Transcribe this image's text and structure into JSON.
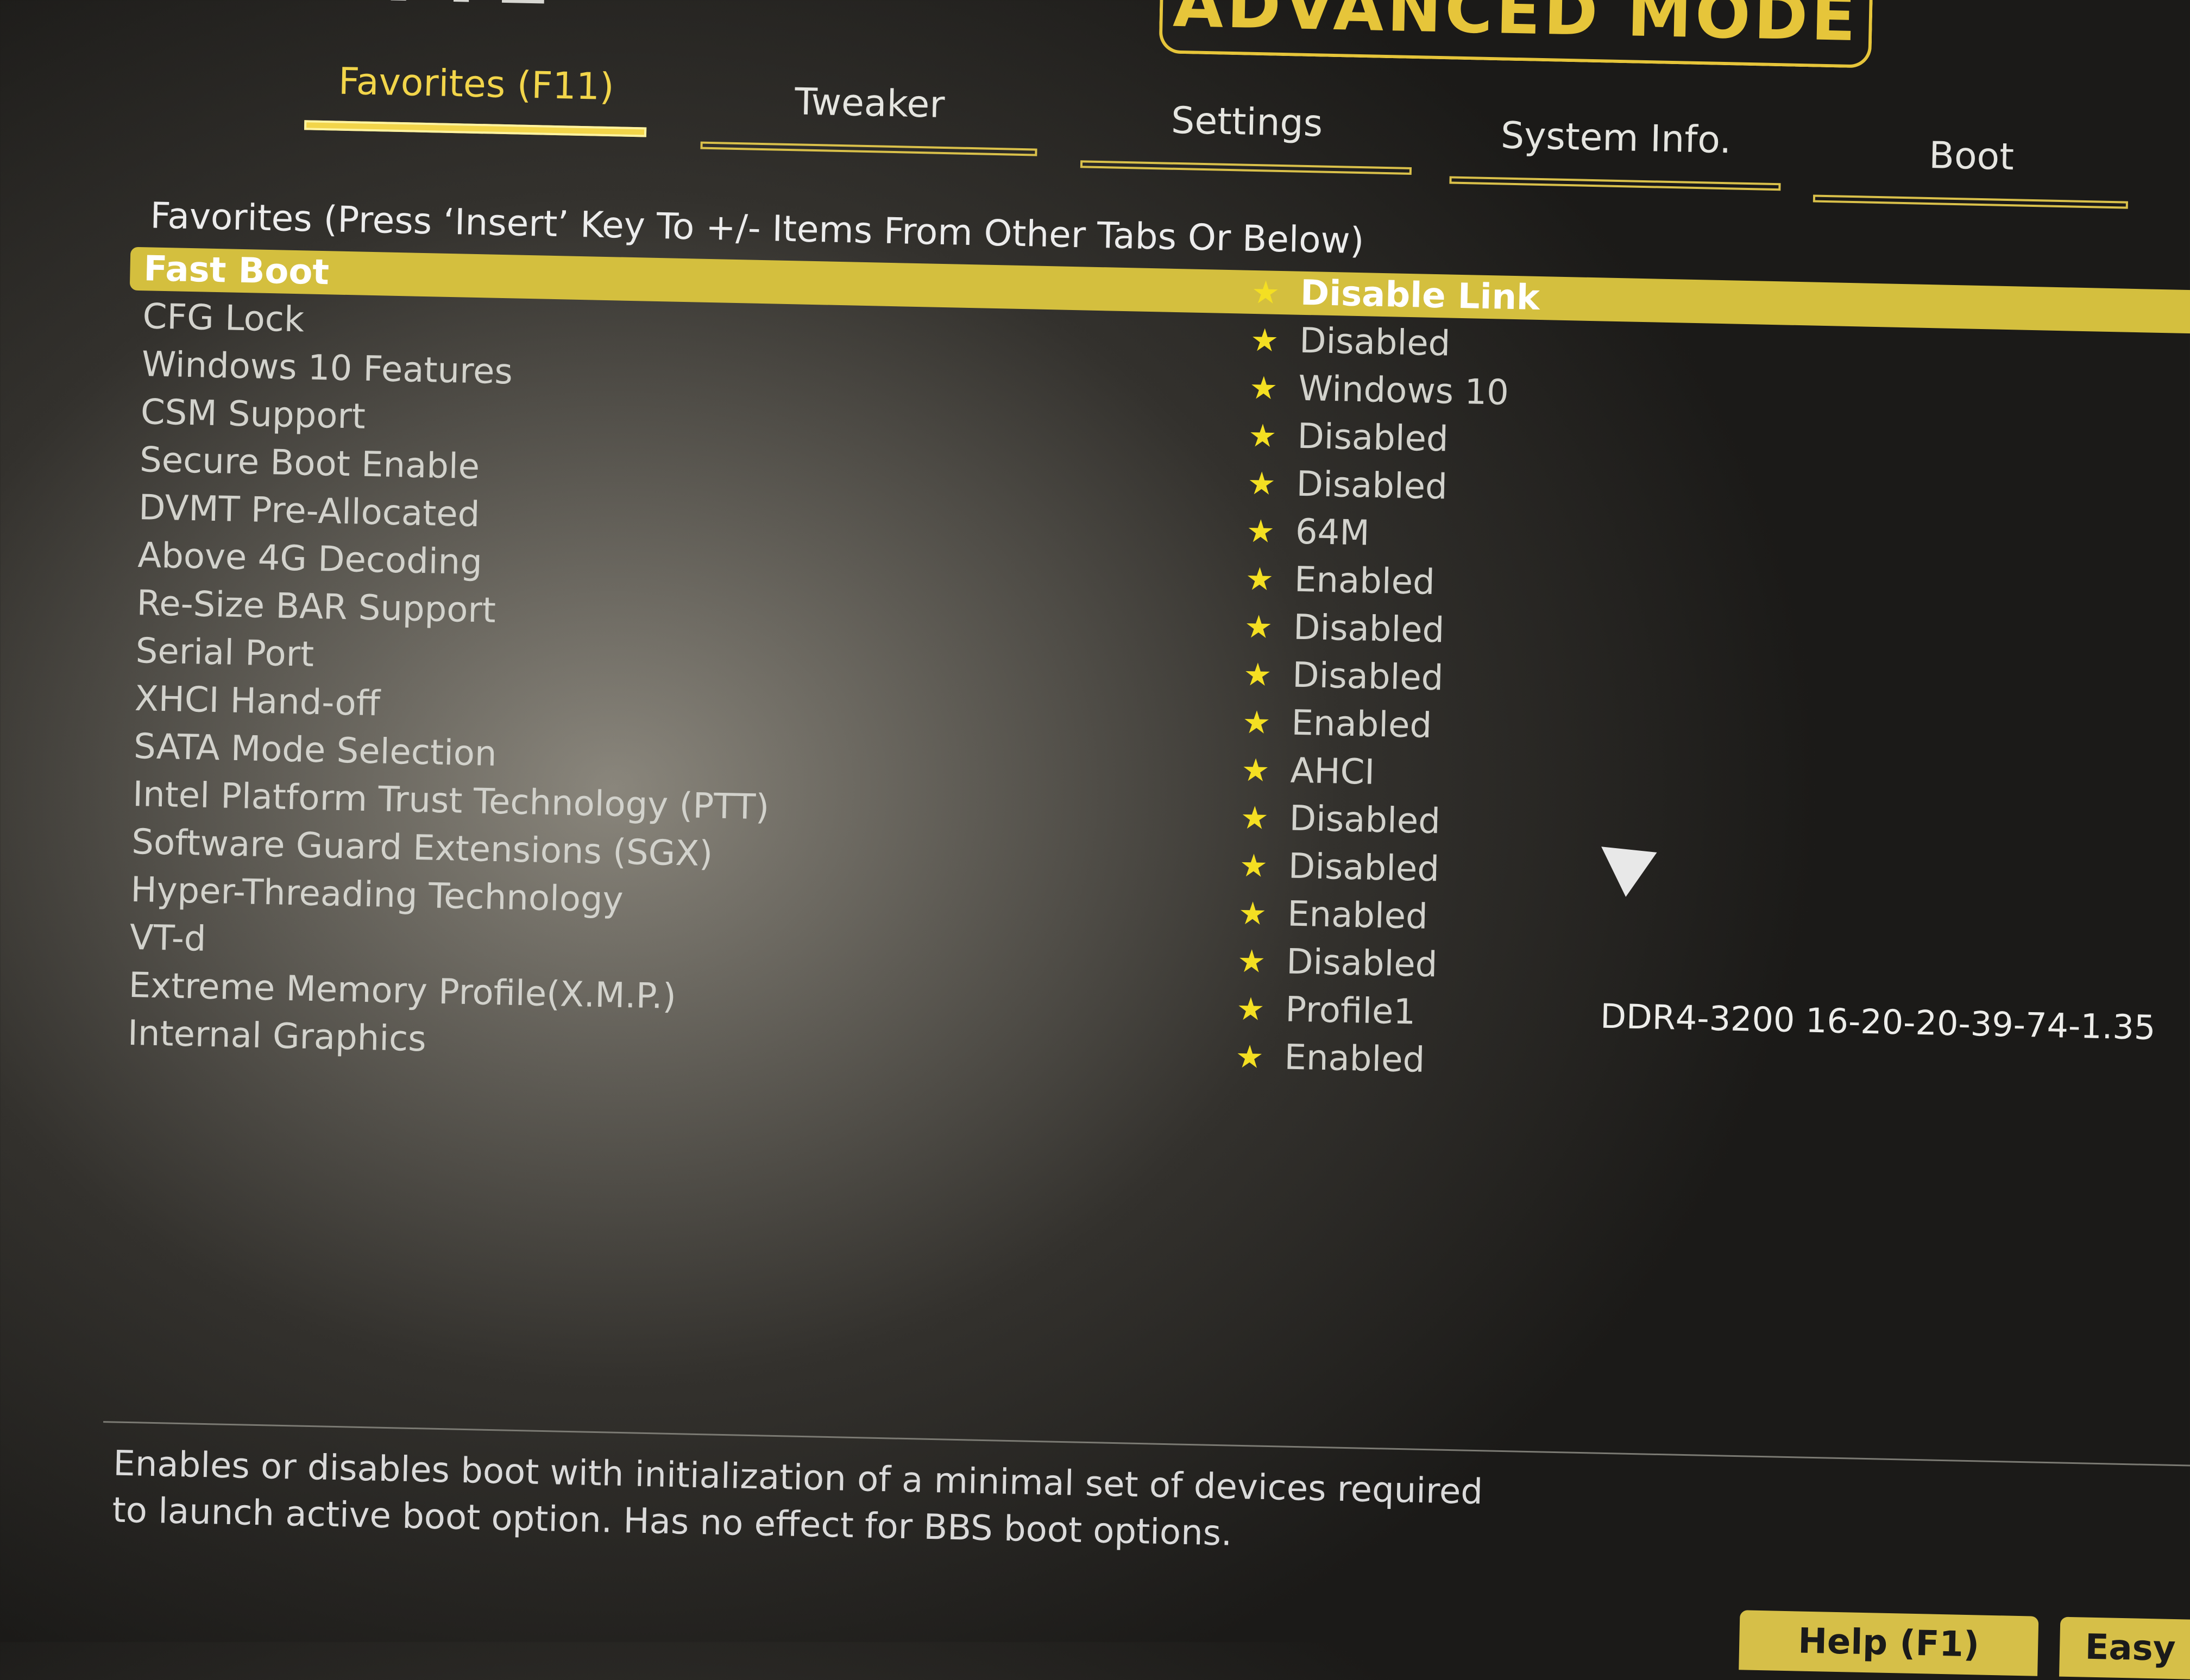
{
  "header": {
    "brand": "GIGABYTE",
    "mode": "ADVANCED MODE"
  },
  "tabs": [
    {
      "label": "Favorites (F11)",
      "active": true
    },
    {
      "label": "Tweaker",
      "active": false
    },
    {
      "label": "Settings",
      "active": false
    },
    {
      "label": "System Info.",
      "active": false
    },
    {
      "label": "Boot",
      "active": false
    }
  ],
  "section_title": "Favorites (Press ‘Insert’ Key To +/- Items From Other Tabs Or Below)",
  "favorites": [
    {
      "label": "Fast Boot",
      "value": "Disable Link",
      "selected": true
    },
    {
      "label": "CFG Lock",
      "value": "Disabled"
    },
    {
      "label": "Windows 10 Features",
      "value": "Windows 10"
    },
    {
      "label": "CSM Support",
      "value": "Disabled"
    },
    {
      "label": "Secure Boot Enable",
      "value": "Disabled"
    },
    {
      "label": "DVMT Pre-Allocated",
      "value": "64M"
    },
    {
      "label": "Above 4G Decoding",
      "value": "Enabled"
    },
    {
      "label": "Re-Size BAR Support",
      "value": "Disabled"
    },
    {
      "label": "Serial Port",
      "value": "Disabled"
    },
    {
      "label": "XHCI Hand-off",
      "value": "Enabled"
    },
    {
      "label": "SATA Mode Selection",
      "value": "AHCI"
    },
    {
      "label": "Intel Platform Trust Technology (PTT)",
      "value": "Disabled"
    },
    {
      "label": "Software Guard Extensions (SGX)",
      "value": "Disabled"
    },
    {
      "label": "Hyper-Threading Technology",
      "value": "Enabled"
    },
    {
      "label": "VT-d",
      "value": "Disabled"
    },
    {
      "label": "Extreme Memory Profile(X.M.P.)",
      "value": "Profile1",
      "extra": "DDR4-3200 16-20-20-39-74-1.35"
    },
    {
      "label": "Internal Graphics",
      "value": "Enabled"
    }
  ],
  "star_icon": "favorite-star-icon",
  "help": {
    "line1": "Enables or disables boot with initialization of a minimal set of devices required",
    "line2": "to launch active boot option. Has no effect for BBS boot options."
  },
  "buttons": {
    "help": "Help (F1)",
    "easy": "Easy"
  },
  "colors": {
    "accent": "#d4bf3e",
    "star": "#f4df22"
  }
}
